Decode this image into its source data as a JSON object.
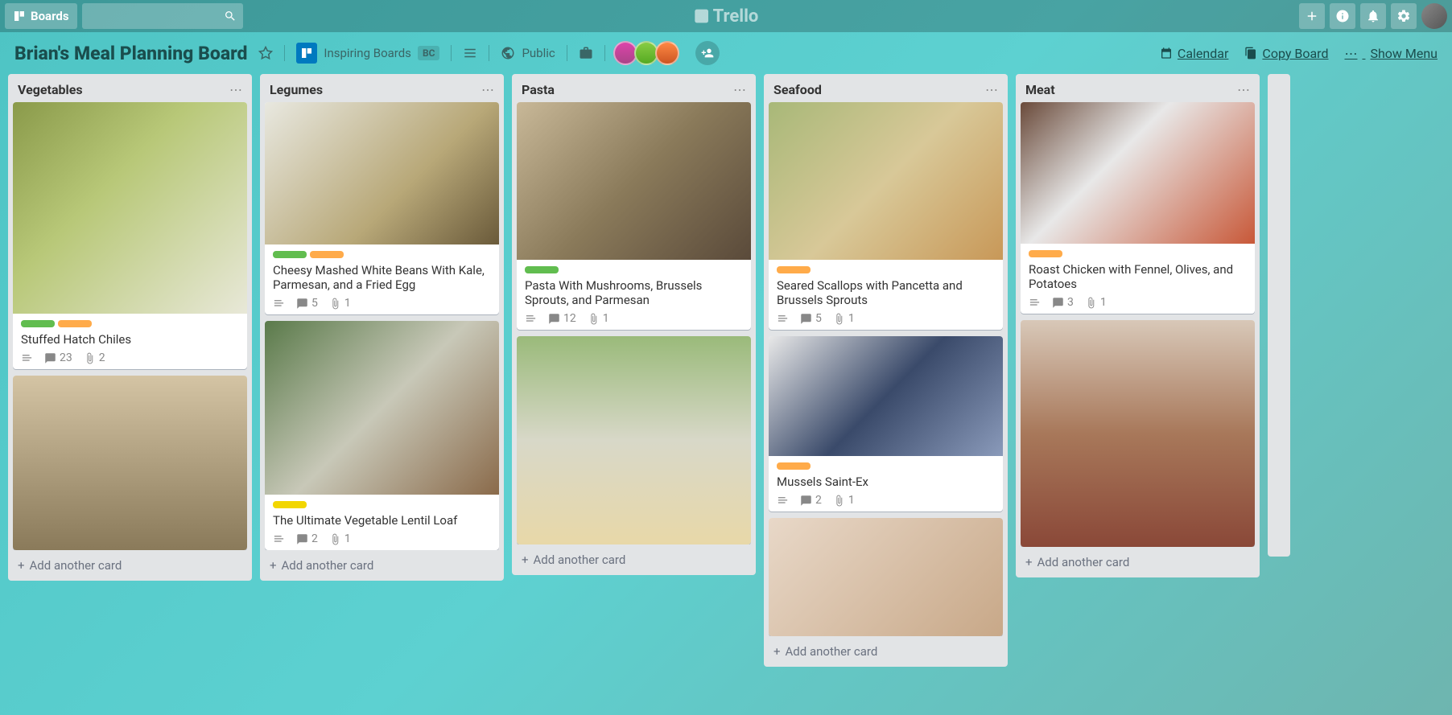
{
  "topbar": {
    "boards_label": "Boards",
    "logo": "Trello"
  },
  "board_header": {
    "title": "Brian's Meal Planning Board",
    "org": "Inspiring Boards",
    "org_badge": "BC",
    "visibility": "Public",
    "calendar": "Calendar",
    "copy": "Copy Board",
    "menu": "Show Menu"
  },
  "lists": [
    {
      "name": "Vegetables",
      "cards": [
        {
          "cover": "cov-a",
          "labels": [
            "lg",
            "lo"
          ],
          "title": "Stuffed Hatch Chiles",
          "desc": true,
          "comments": 23,
          "attach": 2
        },
        {
          "cover": "cov-b"
        }
      ]
    },
    {
      "name": "Legumes",
      "cards": [
        {
          "cover": "cov-c",
          "labels": [
            "lg",
            "lo"
          ],
          "title": "Cheesy Mashed White Beans With Kale, Parmesan, and a Fried Egg",
          "desc": true,
          "comments": 5,
          "attach": 1
        },
        {
          "cover": "cov-d",
          "labels": [
            "ly"
          ],
          "title": "The Ultimate Vegetable Lentil Loaf",
          "desc": true,
          "comments": 2,
          "attach": 1
        }
      ]
    },
    {
      "name": "Pasta",
      "cards": [
        {
          "cover": "cov-e",
          "labels": [
            "lg"
          ],
          "title": "Pasta With Mushrooms, Brussels Sprouts, and Parmesan",
          "desc": true,
          "comments": 12,
          "attach": 1
        },
        {
          "cover": "cov-f"
        }
      ]
    },
    {
      "name": "Seafood",
      "cards": [
        {
          "cover": "cov-g",
          "labels": [
            "lo"
          ],
          "title": "Seared Scallops with Pancetta and Brussels Sprouts",
          "desc": true,
          "comments": 5,
          "attach": 1
        },
        {
          "cover": "cov-h",
          "labels": [
            "lo"
          ],
          "title": "Mussels Saint-Ex",
          "desc": true,
          "comments": 2,
          "attach": 1
        },
        {
          "cover": "cov-k"
        }
      ]
    },
    {
      "name": "Meat",
      "cards": [
        {
          "cover": "cov-i",
          "labels": [
            "lo"
          ],
          "title": "Roast Chicken with Fennel, Olives, and Potatoes",
          "desc": true,
          "comments": 3,
          "attach": 1
        },
        {
          "cover": "cov-j"
        }
      ]
    }
  ],
  "partial_list": "S",
  "add_card_label": "Add another card"
}
